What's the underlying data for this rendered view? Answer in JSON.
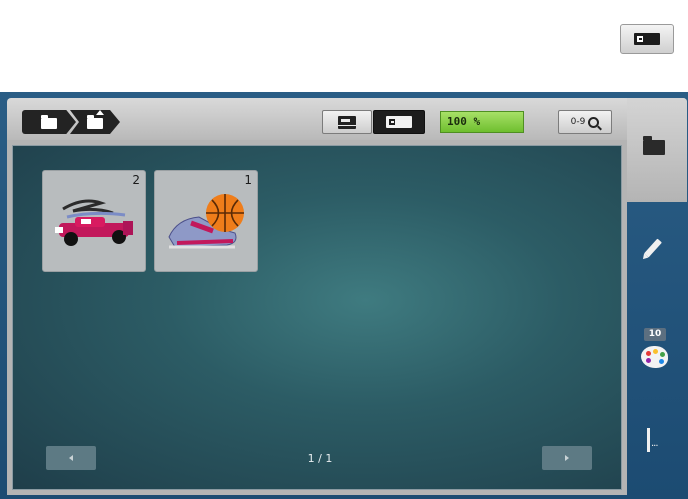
{
  "toolbar": {
    "zoom_value": "100 %",
    "find_label": "0-9"
  },
  "designs": [
    {
      "number": "2",
      "subject": "race-car"
    },
    {
      "number": "1",
      "subject": "basketball-sneaker"
    }
  ],
  "side_panel": {
    "color_count": "10"
  },
  "pagination": {
    "indicator": "1 / 1"
  },
  "colors": {
    "frame_blue": "#1f4c73",
    "panel_teal": "#2c5c65",
    "zoom_green": "#7cc93a",
    "button_dark": "#1d1d1d"
  }
}
